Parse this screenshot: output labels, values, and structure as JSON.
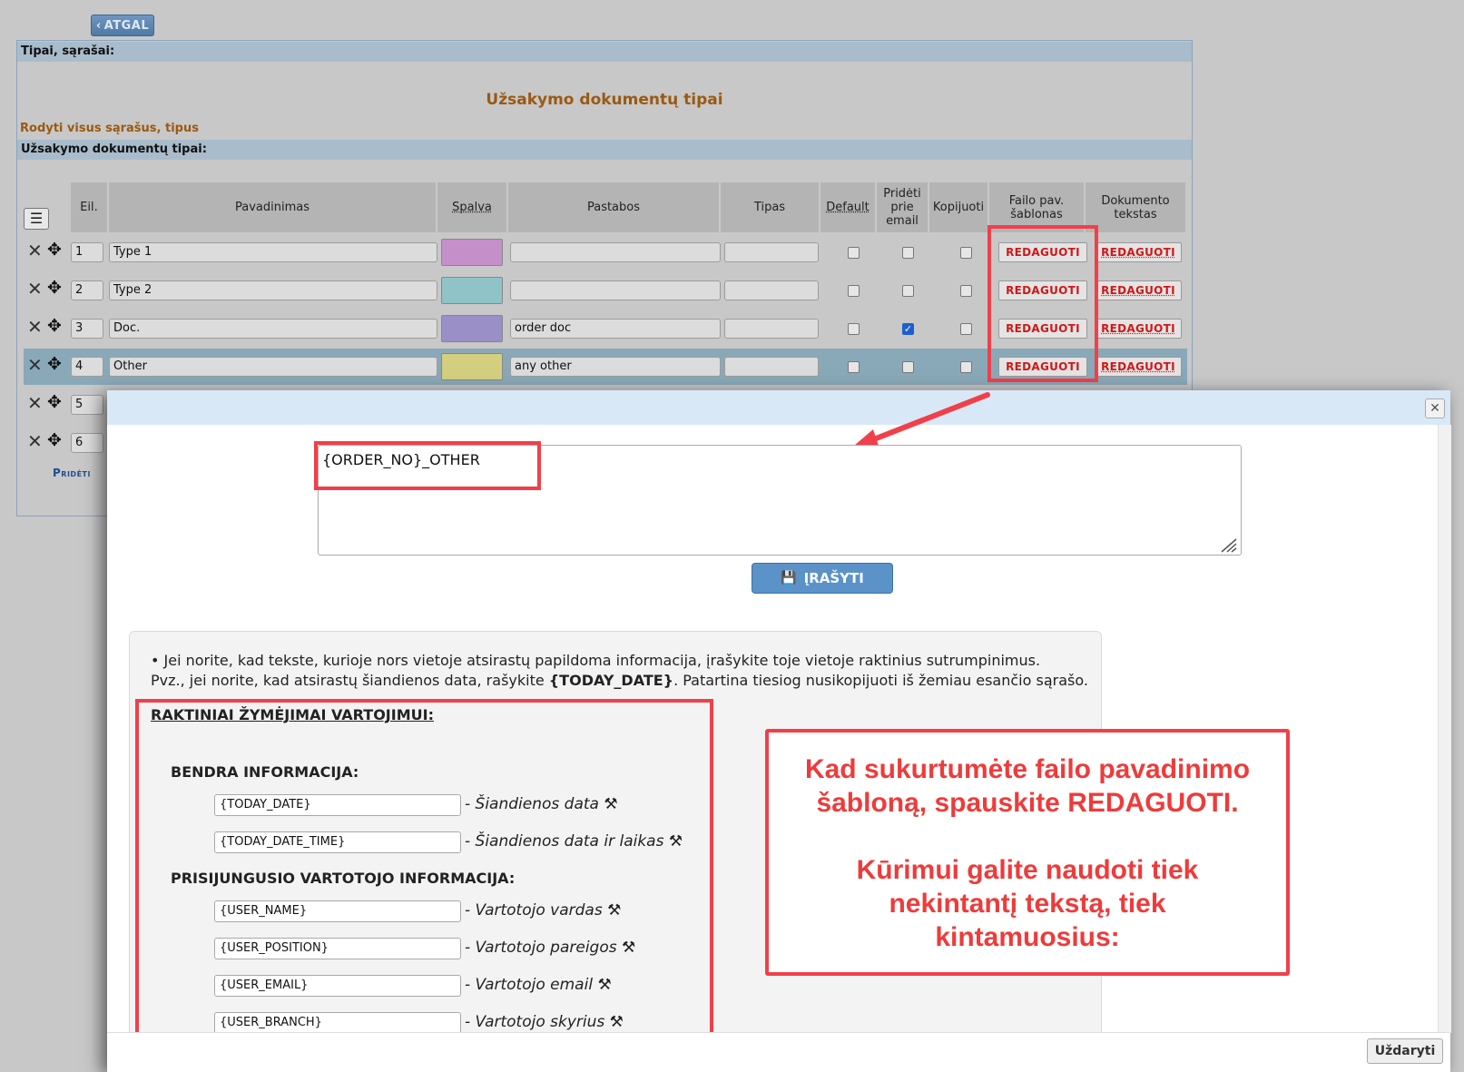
{
  "back_label": "ATGAL",
  "types_bar": "Tipai, sąrašai:",
  "page_title": "Užsakymo dokumentų tipai",
  "show_all_link": "Rodyti visus sąrašus, tipus",
  "section_bar": "Užsakymo dokumentų tipai:",
  "table": {
    "headers": {
      "eil": "Eil.",
      "name": "Pavadinimas",
      "color": "Spalva",
      "notes": "Pastabos",
      "type": "Tipas",
      "default": "Default",
      "attach": "Pridėti prie email",
      "copy": "Kopijuoti",
      "file_tpl": "Failo pav. šablonas",
      "doc_text": "Dokumento tekstas"
    },
    "rows": [
      {
        "no": "1",
        "name": "Type 1",
        "color": "#c58fc9",
        "notes": "",
        "type": "",
        "default": false,
        "attach": false,
        "copy": false
      },
      {
        "no": "2",
        "name": "Type 2",
        "color": "#8fc3c7",
        "notes": "",
        "type": "",
        "default": false,
        "attach": false,
        "copy": false
      },
      {
        "no": "3",
        "name": "Doc.",
        "color": "#9a8fc7",
        "notes": "order doc",
        "type": "",
        "default": false,
        "attach": true,
        "copy": false
      },
      {
        "no": "4",
        "name": "Other",
        "color": "#d4cf7e",
        "notes": "any other",
        "type": "",
        "default": false,
        "attach": false,
        "copy": false
      },
      {
        "no": "5"
      },
      {
        "no": "6"
      }
    ],
    "edit_label": "REDAGUOTI",
    "add_link": "Pridėti"
  },
  "modal": {
    "template_value": "{ORDER_NO}_OTHER",
    "save_label": "ĮRAŠYTI",
    "info_line1": "• Jei norite, kad tekste, kurioje nors vietoje atsirastų papildoma informacija, įrašykite toje vietoje raktinius sutrumpinimus.",
    "info_line2_pre": "Pvz., jei norite, kad atsirastų šiandienos data, rašykite ",
    "info_line2_key": "{TODAY_DATE}",
    "info_line2_post": ". Patartina tiesiog nusikopijuoti iš žemiau esančio sąrašo.",
    "keys_title": "RAKTINIAI ŽYMĖJIMAI VARTOJIMUI:",
    "general_title": "BENDRA INFORMACIJA:",
    "user_title": "PRISIJUNGUSIO VARTOTOJO INFORMACIJA:",
    "keys": [
      {
        "key": "{TODAY_DATE}",
        "desc": "Šiandienos data"
      },
      {
        "key": "{TODAY_DATE_TIME}",
        "desc": "Šiandienos data ir laikas"
      },
      {
        "key": "{USER_NAME}",
        "desc": "Vartotojo vardas"
      },
      {
        "key": "{USER_POSITION}",
        "desc": "Vartotojo pareigos"
      },
      {
        "key": "{USER_EMAIL}",
        "desc": "Vartotojo email"
      },
      {
        "key": "{USER_BRANCH}",
        "desc": "Vartotojo skyrius"
      }
    ],
    "close_label": "Uždaryti"
  },
  "callout": {
    "line1": "Kad sukurtumėte failo pavadinimo",
    "line2": "šabloną, spauskite REDAGUOTI.",
    "line3": "Kūrimui galite naudoti tiek",
    "line4": "nekintantį tekstą, tiek",
    "line5": "kintamuosius:"
  },
  "colors": {
    "accent_red": "#f0404a",
    "title_orange": "#9a5a12",
    "button_blue": "#5b92c8"
  }
}
